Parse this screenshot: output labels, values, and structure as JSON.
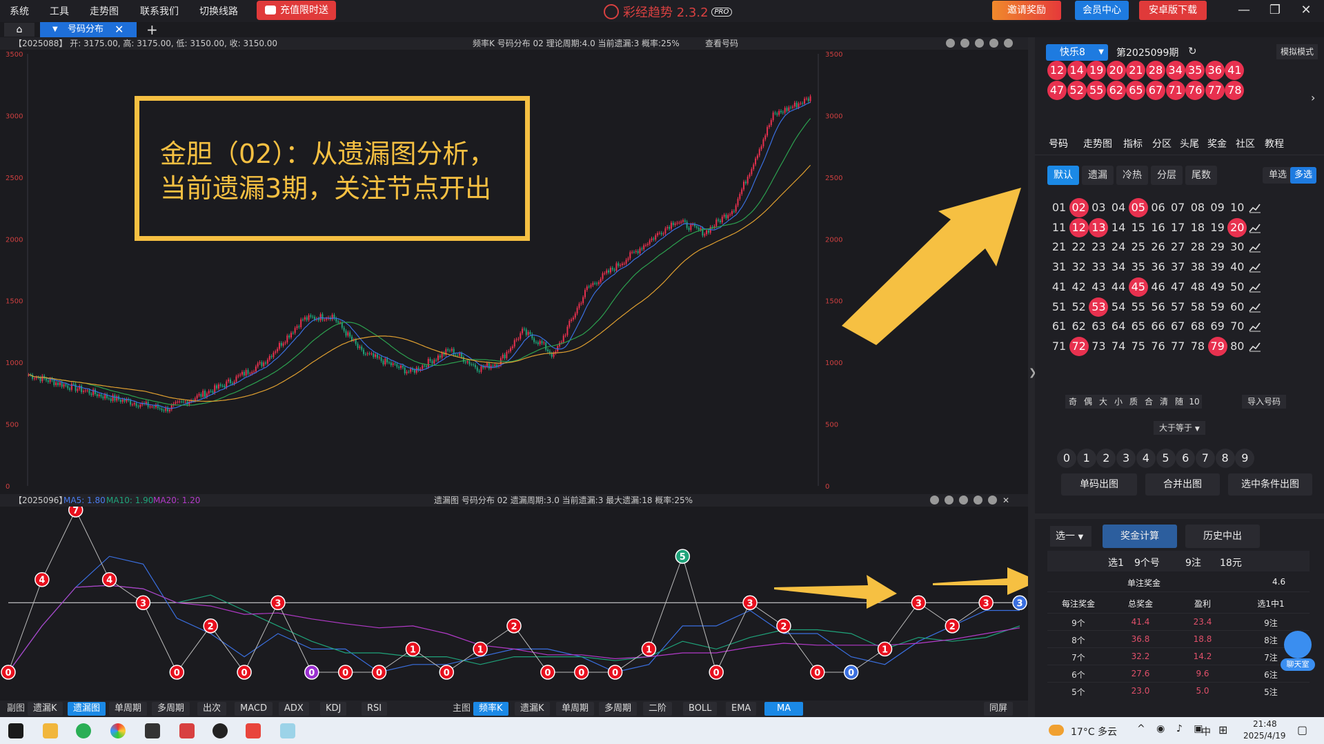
{
  "menu": [
    "系统",
    "工具",
    "走势图",
    "联系我们",
    "切换线路"
  ],
  "promo_label": "充值限时送",
  "app": {
    "title": "彩经趋势 2.3.2",
    "badge": "PRO"
  },
  "top_buttons": {
    "invite": "邀请奖励",
    "member": "会员中心",
    "android": "安卓版下载"
  },
  "tabs": {
    "active": "号码分布"
  },
  "main_chart": {
    "header_left": "【2025088】  开: 3175.00, 高: 3175.00, 低: 3150.00, 收: 3150.00",
    "header_mid": "频率K   号码分布  02    理论周期:4.0  当前遗漏:3  概率:25%",
    "header_btn": "查看号码",
    "y_ticks": [
      "3500",
      "3000",
      "2500",
      "2000",
      "1500",
      "1000",
      "500",
      "0"
    ]
  },
  "sub_chart": {
    "header_left": "【2025096】",
    "ma5": "MA5: 1.80",
    "ma10": "MA10: 1.90",
    "ma20": "MA20: 1.20",
    "header_mid": "遗漏图   号码分布  02    遗漏周期:3.0  当前遗漏:3  最大遗漏:18  概率:25%"
  },
  "annotation": {
    "line1": "金胆（02）：从遗漏图分析，",
    "line2": "当前遗漏3期，关注节点开出"
  },
  "chart_data": {
    "type": "line",
    "title": "遗漏图 号码分布 02",
    "xlabel": "",
    "ylabel": "",
    "values": [
      0,
      4,
      7,
      4,
      3,
      0,
      2,
      0,
      3,
      0,
      0,
      0,
      1,
      0,
      1,
      2,
      0,
      0,
      0,
      1,
      5,
      0,
      3,
      2,
      0,
      0,
      1,
      3,
      2,
      3,
      3
    ],
    "ylim": [
      0,
      7
    ]
  },
  "bottom_bar": {
    "sub_label": "副图",
    "sub_tabs": [
      "遗漏K",
      "遗漏图",
      "单周期",
      "多周期",
      "出次",
      "MACD",
      "ADX",
      "KDJ",
      "RSI"
    ],
    "main_label": "主图",
    "main_tabs": [
      "频率K",
      "遗漏K",
      "单周期",
      "多周期",
      "二阶",
      "BOLL",
      "EMA",
      "MA"
    ],
    "sync": "同屏"
  },
  "right": {
    "lottery": "快乐8",
    "issue": "第2025099期",
    "mode": "模拟模式",
    "balls_row1": [
      "12",
      "14",
      "19",
      "20",
      "21",
      "28",
      "34",
      "35",
      "36",
      "41"
    ],
    "balls_row2": [
      "47",
      "52",
      "55",
      "62",
      "65",
      "67",
      "71",
      "76",
      "77",
      "78"
    ],
    "nav_tabs": [
      "号码",
      "走势图",
      "指标",
      "分区",
      "头尾",
      "奖金",
      "社区",
      "教程"
    ],
    "filters": [
      "默认",
      "遗漏",
      "冷热",
      "分层",
      "尾数"
    ],
    "single": "单选",
    "multi": "多选",
    "grid": [
      [
        "01",
        "02",
        "03",
        "04",
        "05",
        "06",
        "07",
        "08",
        "09",
        "10"
      ],
      [
        "11",
        "12",
        "13",
        "14",
        "15",
        "16",
        "17",
        "18",
        "19",
        "20"
      ],
      [
        "21",
        "22",
        "23",
        "24",
        "25",
        "26",
        "27",
        "28",
        "29",
        "30"
      ],
      [
        "31",
        "32",
        "33",
        "34",
        "35",
        "36",
        "37",
        "38",
        "39",
        "40"
      ],
      [
        "41",
        "42",
        "43",
        "44",
        "45",
        "46",
        "47",
        "48",
        "49",
        "50"
      ],
      [
        "51",
        "52",
        "53",
        "54",
        "55",
        "56",
        "57",
        "58",
        "59",
        "60"
      ],
      [
        "61",
        "62",
        "63",
        "64",
        "65",
        "66",
        "67",
        "68",
        "69",
        "70"
      ],
      [
        "71",
        "72",
        "73",
        "74",
        "75",
        "76",
        "77",
        "78",
        "79",
        "80"
      ]
    ],
    "selected": [
      "02",
      "05",
      "12",
      "13",
      "20",
      "45",
      "53",
      "72",
      "79"
    ],
    "chips": [
      "奇",
      "偶",
      "大",
      "小",
      "质",
      "合",
      "清",
      "随",
      "10"
    ],
    "import": "导入号码",
    "ge_label": "大于等于",
    "digits": [
      "0",
      "1",
      "2",
      "3",
      "4",
      "5",
      "6",
      "7",
      "8",
      "9"
    ],
    "actions": [
      "单码出图",
      "合并出图",
      "选中条件出图"
    ],
    "select_label": "选一",
    "calc": "奖金计算",
    "history": "历史中出",
    "summary": [
      "选1",
      "9个号",
      "9注",
      "18元"
    ],
    "unit_prize_label": "单注奖金",
    "unit_prize": "4.6",
    "table_head": [
      "每注奖金",
      "总奖金",
      "盈利",
      "选1中1"
    ],
    "table_rows": [
      [
        "9个",
        "41.4",
        "23.4",
        "9注"
      ],
      [
        "8个",
        "36.8",
        "18.8",
        "8注"
      ],
      [
        "7个",
        "32.2",
        "14.2",
        "7注"
      ],
      [
        "6个",
        "27.6",
        "9.6",
        "6注"
      ],
      [
        "5个",
        "23.0",
        "5.0",
        "5注"
      ]
    ],
    "chat": "聊天室"
  },
  "taskbar": {
    "weather": "17°C 多云",
    "time": "21:48",
    "date": "2025/4/19",
    "ime": "中"
  }
}
